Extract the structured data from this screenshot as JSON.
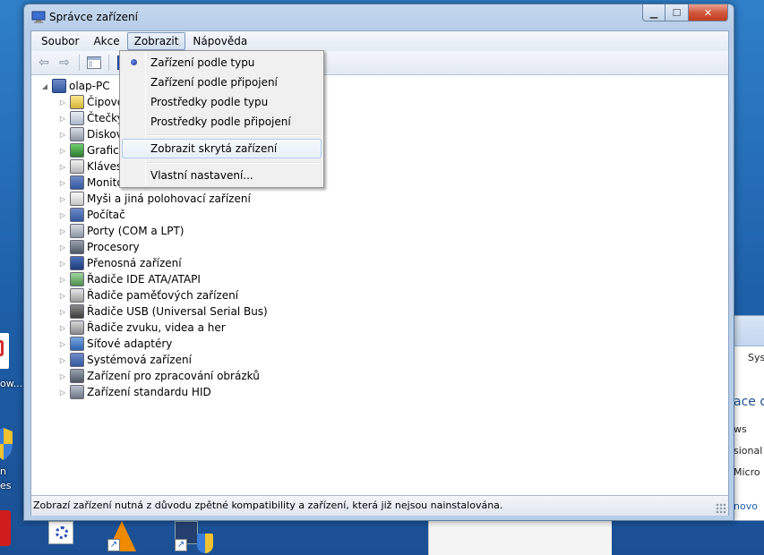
{
  "window": {
    "title": "Správce zařízení"
  },
  "menubar": {
    "items": [
      "Soubor",
      "Akce",
      "Zobrazit",
      "Nápověda"
    ],
    "active_index": 2
  },
  "view_menu": {
    "items": [
      {
        "label": "Zařízení podle typu",
        "selected": true
      },
      {
        "label": "Zařízení podle připojení"
      },
      {
        "label": "Prostředky podle typu"
      },
      {
        "label": "Prostředky podle připojení"
      },
      {
        "label": "Zobrazit skrytá zařízení",
        "highlighted": true
      },
      {
        "label": "Vlastní nastavení..."
      }
    ]
  },
  "tree": {
    "root": "olap-PC",
    "items": [
      {
        "label": "Čipové",
        "icon": "chip-icon"
      },
      {
        "label": "Čtečky",
        "icon": "reader-icon"
      },
      {
        "label": "Diskov",
        "icon": "disk-icon"
      },
      {
        "label": "Grafick",
        "icon": "display-adapter-icon"
      },
      {
        "label": "Kláves",
        "icon": "keyboard-icon"
      },
      {
        "label": "Monito",
        "icon": "monitor-icon"
      },
      {
        "label": "Myši a jiná polohovací zařízení",
        "icon": "mouse-icon"
      },
      {
        "label": "Počítač",
        "icon": "computer-icon"
      },
      {
        "label": "Porty (COM a LPT)",
        "icon": "port-icon"
      },
      {
        "label": "Procesory",
        "icon": "processor-icon"
      },
      {
        "label": "Přenosná zařízení",
        "icon": "portable-device-icon"
      },
      {
        "label": "Řadiče IDE ATA/ATAPI",
        "icon": "ide-controller-icon"
      },
      {
        "label": "Řadiče paměťových zařízení",
        "icon": "storage-controller-icon"
      },
      {
        "label": "Řadiče USB (Universal Serial Bus)",
        "icon": "usb-icon"
      },
      {
        "label": "Řadiče zvuku, videa a her",
        "icon": "sound-icon"
      },
      {
        "label": "Síťové adaptéry",
        "icon": "network-adapter-icon"
      },
      {
        "label": "Systémová zařízení",
        "icon": "system-device-icon"
      },
      {
        "label": "Zařízení pro zpracování obrázků",
        "icon": "imaging-device-icon"
      },
      {
        "label": "Zařízení standardu HID",
        "icon": "hid-icon"
      }
    ]
  },
  "statusbar": {
    "text": "Zobrazí zařízení nutná z důvodu zpětné kompatibility a zařízení, která již nejsou nainstalována."
  },
  "background": {
    "desktop_labels": [
      "ow...",
      "n",
      "es"
    ],
    "window_fragments": [
      "Sys",
      "ace o",
      "ws",
      "sional",
      "Micro",
      "novo"
    ]
  },
  "colors": {
    "desktop": "#1d5fa8",
    "title_bar": "#b7cde8",
    "menu_highlight_border": "#aecbee",
    "close_button": "#c23c22"
  }
}
